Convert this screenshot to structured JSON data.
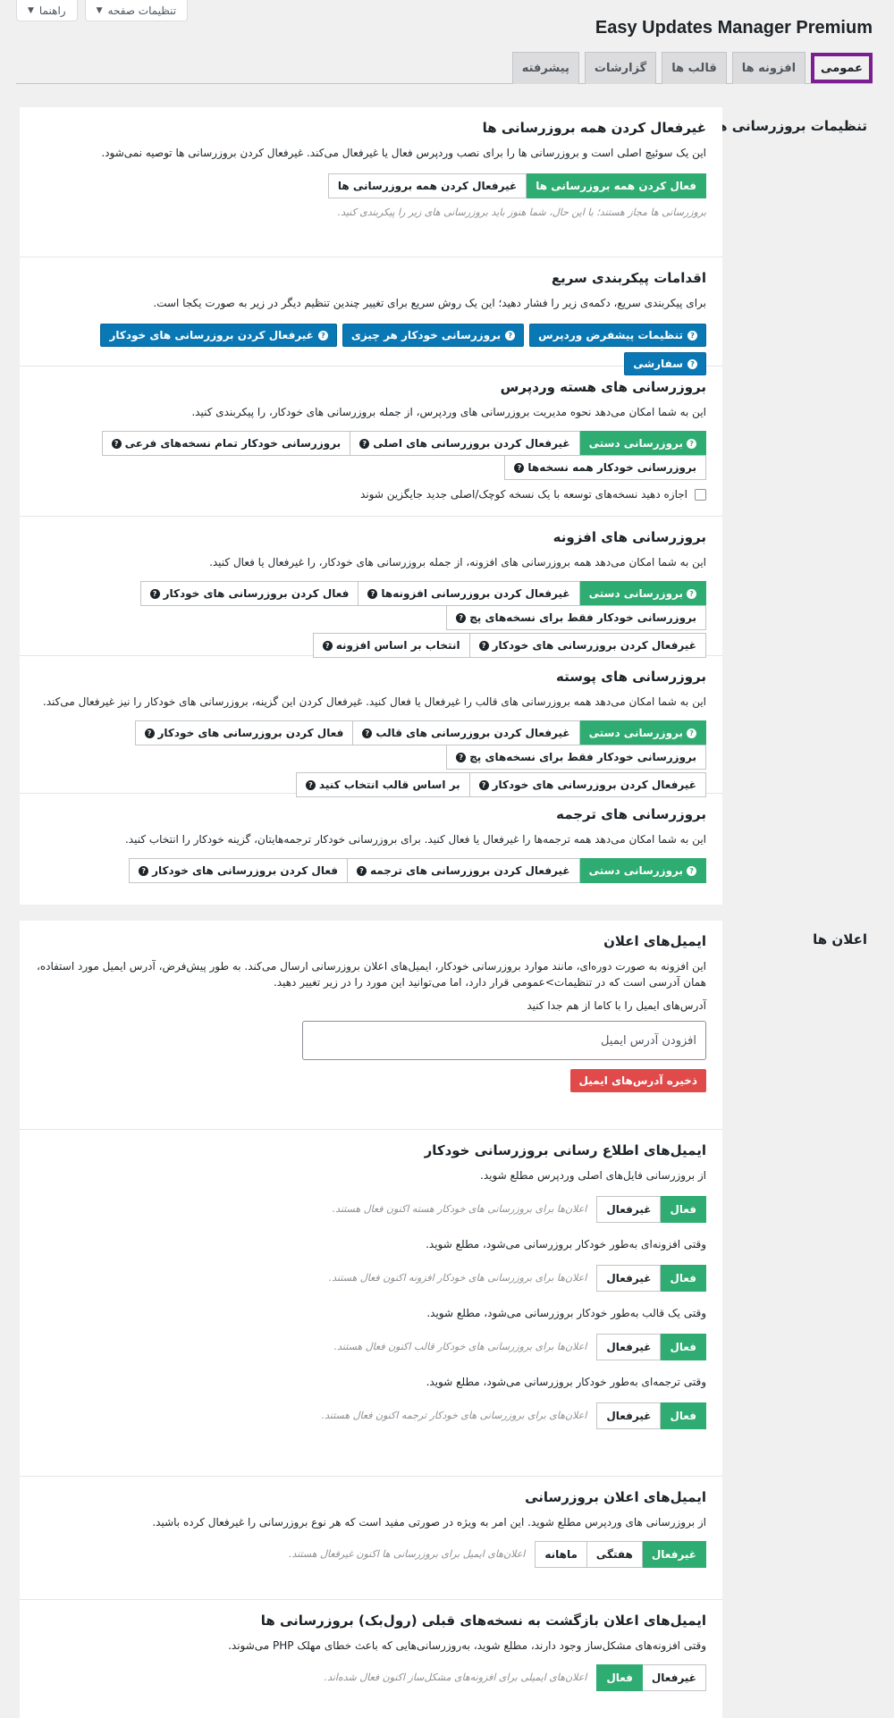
{
  "screen_options": {
    "page_settings": "تنظیمات صفحه",
    "help": "راهنما"
  },
  "title": "Easy Updates Manager Premium",
  "tabs": [
    "عمومی",
    "افزونه ها",
    "قالب ها",
    "گزارشات",
    "پیشرفته"
  ],
  "sections": {
    "updates": "تنظیمات بروزرسانی ها",
    "notifications": "اعلان ها"
  },
  "disable_all": {
    "title": "غیرفعال کردن همه بروزرسانی ها",
    "desc": "این یک سوئیچ اصلی است و بروزرسانی ها را برای نصب وردپرس فعال یا غیرفعال می‌کند. غیرفعال کردن بروزرسانی ها توصیه نمی‌شود.",
    "enable": "فعال کردن همه بروزرسانی ها",
    "disable": "غیرفعال کردن همه بروزرسانی ها",
    "hint": "بروزرسانی ها مجاز هستند؛ با این حال، شما هنوز باید بروزرسانی های زیر را پیکربندی کنید."
  },
  "quick": {
    "title": "اقدامات پیکربندی سریع",
    "desc": "برای پیکربندی سریع، دکمه‌ی زیر را فشار دهید؛ این یک روش سریع برای تغییر چندین تنظیم دیگر در زیر به صورت یکجا است.",
    "buttons": [
      "تنظیمات پیشفرض وردپرس",
      "بروزرسانی خودکار هر چیزی",
      "غیرفعال کردن بروزرسانی های خودکار",
      "سفارشی"
    ]
  },
  "core": {
    "title": "بروزرسانی های هسته وردپرس",
    "desc": "این به شما امکان می‌دهد نحوه مدیریت بروزرسانی های وردپرس، از جمله بروزرسانی های خودکار، را پیکربندی کنید.",
    "buttons": [
      "بروزرسانی دستی",
      "غیرفعال کردن بروزرسانی های اصلی",
      "بروزرسانی خودکار تمام نسخه‌های فرعی",
      "بروزرسانی خودکار همه نسخه‌ها"
    ],
    "checkbox": "اجازه دهید نسخه‌های توسعه با یک نسخه کوچک/اصلی جدید جایگزین شوند"
  },
  "plugins": {
    "title": "بروزرسانی های افزونه",
    "desc": "این به شما امکان می‌دهد همه بروزرسانی های افزونه، از جمله بروزرسانی های خودکار، را غیرفعال یا فعال کنید.",
    "row1": [
      "بروزرسانی دستی",
      "غیرفعال کردن بروزرسانی افزونه‌ها",
      "فعال کردن بروزرسانی های خودکار",
      "بروزرسانی خودکار فقط برای نسخه‌های پچ"
    ],
    "row2": [
      "غیرفعال کردن بروزرسانی های خودکار",
      "انتخاب بر اساس افزونه"
    ]
  },
  "themes": {
    "title": "بروزرسانی های پوسته",
    "desc": "این به شما امکان می‌دهد همه بروزرسانی های قالب را غیرفعال یا فعال کنید. غیرفعال کردن این گزینه، بروزرسانی های خودکار را نیز غیرفعال می‌کند.",
    "row1": [
      "بروزرسانی دستی",
      "غیرفعال کردن بروزرسانی های قالب",
      "فعال کردن بروزرسانی های خودکار",
      "بروزرسانی خودکار فقط برای نسخه‌های پچ"
    ],
    "row2": [
      "غیرفعال کردن بروزرسانی های خودکار",
      "بر اساس قالب انتخاب کنید"
    ]
  },
  "translations": {
    "title": "بروزرسانی های ترجمه",
    "desc": "این به شما امکان می‌دهد همه ترجمه‌ها را غیرفعال یا فعال کنید. برای بروزرسانی خودکار ترجمه‌هایتان، گزینه خودکار را انتخاب کنید.",
    "buttons": [
      "بروزرسانی دستی",
      "غیرفعال کردن بروزرسانی های ترجمه",
      "فعال کردن بروزرسانی های خودکار"
    ]
  },
  "notify_email": {
    "title": "ایمیل‌های اعلان",
    "desc": "این افزونه به صورت دوره‌ای، مانند موارد بروزرسانی خودکار، ایمیل‌های اعلان بروزرسانی ارسال می‌کند. به طور پیش‌فرض، آدرس ایمیل مورد استفاده، همان آدرسی است که در تنظیمات>عمومی قرار دارد، اما می‌توانید این مورد را در زیر تغییر دهید.",
    "label": "آدرس‌های ایمیل را با کاما از هم جدا کنید",
    "placeholder": "افزودن آدرس ایمیل",
    "save": "ذخیره آدرس‌های ایمیل"
  },
  "auto_notify": {
    "title": "ایمیل‌های اطلاع رسانی بروزرسانی خودکار",
    "off": "غیرفعال",
    "on": "فعال",
    "items": [
      {
        "q": "از بروزرسانی فایل‌های اصلی وردپرس مطلع شوید.",
        "hint": "اعلان‌ها برای بروزرسانی های خودکار هسته اکنون فعال هستند."
      },
      {
        "q": "وقتی افزونه‌ای به‌طور خودکار بروزرسانی می‌شود، مطلع شوید.",
        "hint": "اعلان‌ها برای بروزرسانی های خودکار افزونه اکنون فعال هستند."
      },
      {
        "q": "وقتی یک قالب به‌طور خودکار بروزرسانی می‌شود، مطلع شوید.",
        "hint": "اعلان‌ها برای بروزرسانی های خودکار قالب اکنون فعال هستند."
      },
      {
        "q": "وقتی ترجمه‌ای به‌طور خودکار بروزرسانی می‌شود، مطلع شوید.",
        "hint": "اعلان‌های برای بروزرسانی های خودکار ترجمه اکنون فعال هستند."
      }
    ]
  },
  "update_notify": {
    "title": "ایمیل‌های اعلان بروزرسانی",
    "desc": "از بروزرسانی های وردپرس مطلع شوید. این امر به ویژه در صورتی مفید است که هر نوع بروزرسانی را غیرفعال کرده باشید.",
    "buttons": [
      "غیرفعال",
      "هفتگی",
      "ماهانه"
    ],
    "hint": "اعلان‌های ایمیل برای بروزرسانی ها اکنون غیرفعال هستند."
  },
  "rollback": {
    "title": "ایمیل‌های اعلان بازگشت به نسخه‌های قبلی (رول‌بک) بروزرسانی ها",
    "desc": "وقتی افزونه‌های مشکل‌ساز وجود دارند، مطلع شوید، به‌روزرسانی‌هایی که باعث خطای مهلک PHP می‌شوند.",
    "off": "غیرفعال",
    "on": "فعال",
    "hint": "اعلان‌های ایمیلی برای افزونه‌های مشکل‌ساز اکنون فعال شده‌اند."
  }
}
